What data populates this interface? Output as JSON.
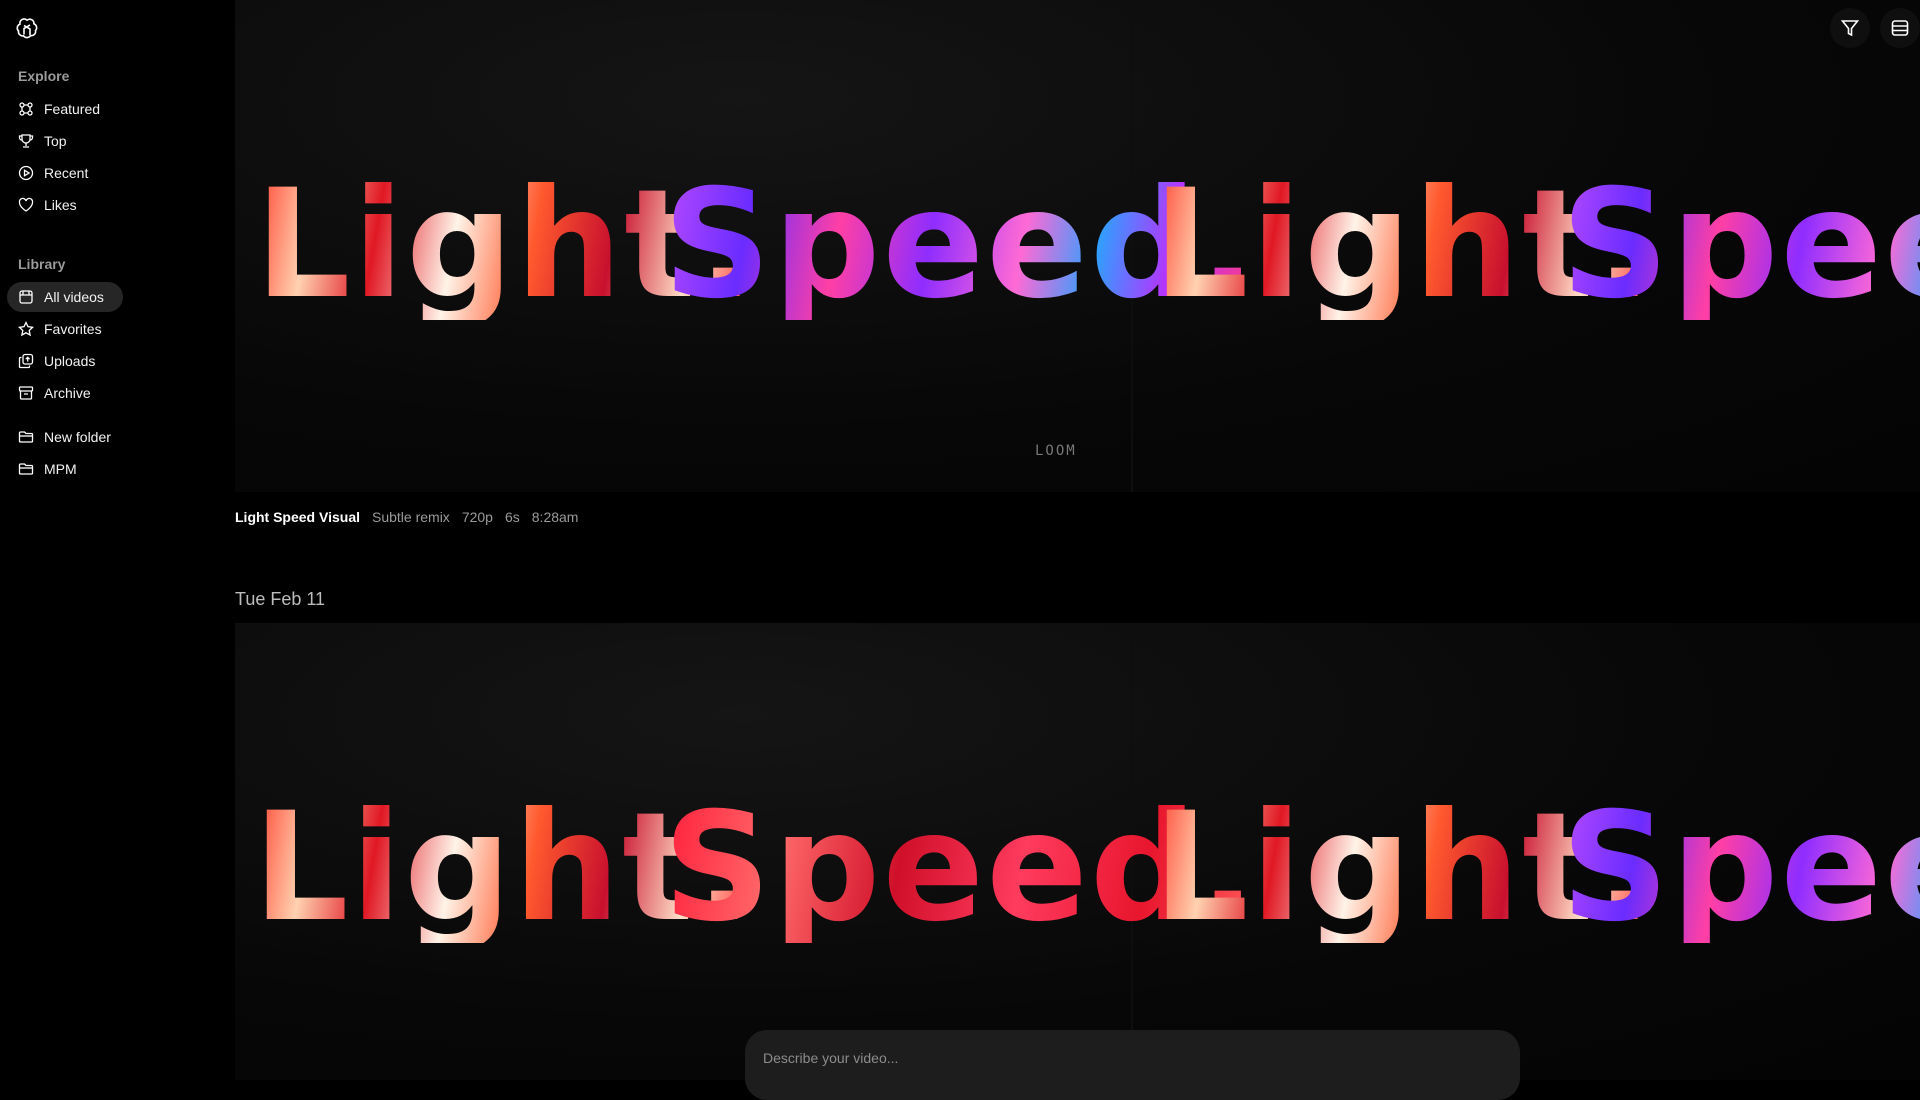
{
  "sidebar": {
    "explore_title": "Explore",
    "explore_items": [
      {
        "label": "Featured",
        "icon": "featured-icon"
      },
      {
        "label": "Top",
        "icon": "trophy-icon"
      },
      {
        "label": "Recent",
        "icon": "play-circle-icon"
      },
      {
        "label": "Likes",
        "icon": "heart-icon"
      }
    ],
    "library_title": "Library",
    "library_items": [
      {
        "label": "All videos",
        "icon": "videos-icon",
        "active": true
      },
      {
        "label": "Favorites",
        "icon": "star-icon"
      },
      {
        "label": "Uploads",
        "icon": "uploads-icon"
      },
      {
        "label": "Archive",
        "icon": "archive-icon"
      }
    ],
    "folder_items": [
      {
        "label": "New folder",
        "icon": "new-folder-icon"
      },
      {
        "label": "MPM",
        "icon": "folder-icon"
      }
    ]
  },
  "video1": {
    "frame_text_left_a": "Light.",
    "frame_text_left_b": "Speed.",
    "frame_text_right_a": "Light.",
    "frame_text_right_b": "Speed",
    "watermark": "LOOM",
    "title": "Light Speed Visual",
    "variant": "Subtle remix",
    "resolution": "720p",
    "duration": "6s",
    "time": "8:28am"
  },
  "date_heading": "Tue Feb 11",
  "video2": {
    "frame_text_left_a": "Light.",
    "frame_text_left_b": "Speed.",
    "frame_text_right_a": "Light.",
    "frame_text_right_b": "Speed"
  },
  "prompt": {
    "placeholder": "Describe your video..."
  },
  "toolbar": {
    "filter_icon": "filter-icon",
    "layout_icon": "layout-icon"
  }
}
